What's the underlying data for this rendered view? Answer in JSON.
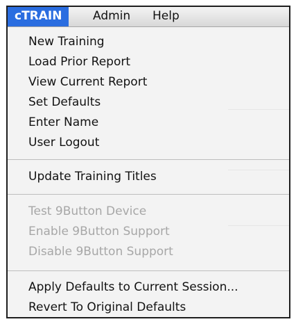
{
  "menubar": {
    "items": [
      {
        "label": "cTRAIN"
      },
      {
        "label": "Admin"
      },
      {
        "label": "Help"
      }
    ]
  },
  "menu": {
    "group1": [
      {
        "label": "New Training",
        "enabled": true
      },
      {
        "label": "Load Prior Report",
        "enabled": true
      },
      {
        "label": "View Current Report",
        "enabled": true
      },
      {
        "label": "Set Defaults",
        "enabled": true
      },
      {
        "label": "Enter Name",
        "enabled": true
      },
      {
        "label": "User Logout",
        "enabled": true
      }
    ],
    "group2": [
      {
        "label": "Update Training Titles",
        "enabled": true
      }
    ],
    "group3": [
      {
        "label": "Test 9Button Device",
        "enabled": false
      },
      {
        "label": "Enable 9Button Support",
        "enabled": false
      },
      {
        "label": "Disable 9Button Support",
        "enabled": false
      }
    ],
    "group4": [
      {
        "label": "Apply Defaults to Current Session...",
        "enabled": true
      },
      {
        "label": "Revert To Original Defaults",
        "enabled": true
      }
    ]
  },
  "colors": {
    "accent": "#2a6de0",
    "disabled_text": "#a7a7a7",
    "menu_bg": "#f3f3f3"
  }
}
